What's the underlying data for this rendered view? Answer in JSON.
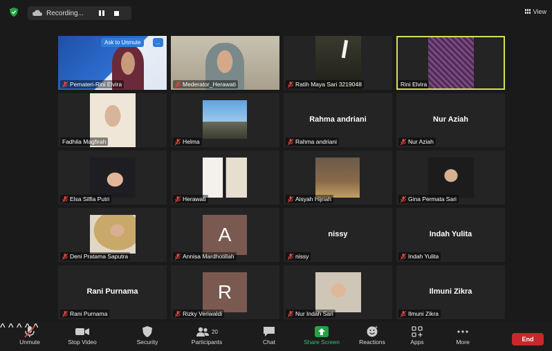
{
  "topbar": {
    "recording_label": "Recording...",
    "view_label": "View"
  },
  "tip": {
    "ask_unmute": "Ask to Unmute",
    "more": "..."
  },
  "tiles": [
    {
      "name": "Pemateri-Rini Elvira"
    },
    {
      "name": "Mederator_Herawati"
    },
    {
      "name": "Ratih Maya Sari 3219048"
    },
    {
      "name": "Rini Elvira"
    },
    {
      "name": "Fadhila Magfirah"
    },
    {
      "name": "Helma"
    },
    {
      "name": "Rahma andriani",
      "big": "Rahma andriani"
    },
    {
      "name": "Nur Aziah",
      "big": "Nur Aziah"
    },
    {
      "name": "Elsa Silfia Putri"
    },
    {
      "name": "Herawati"
    },
    {
      "name": "Aisyah Hijriah"
    },
    {
      "name": "Gina Permata Sari"
    },
    {
      "name": "Deni Pratama Saputra"
    },
    {
      "name": "Annisa Mardhotillah",
      "letter": "A"
    },
    {
      "name": "nissy",
      "big": "nissy"
    },
    {
      "name": "Indah Yulita",
      "big": "Indah Yulita"
    },
    {
      "name": "Rani Purnama",
      "big": "Rani Purnama"
    },
    {
      "name": "Rizky Veriwaldi",
      "letter": "R"
    },
    {
      "name": "Nur Indah Sari"
    },
    {
      "name": "Ilmuni Zikra",
      "big": "Ilmuni Zikra"
    }
  ],
  "toolbar": {
    "unmute": "Unmute",
    "stop_video": "Stop Video",
    "security": "Security",
    "participants": "Participants",
    "participants_count": "20",
    "chat": "Chat",
    "share_screen": "Share Screen",
    "reactions": "Reactions",
    "apps": "Apps",
    "more": "More",
    "end": "End"
  },
  "colors": {
    "active_speaker": "#d8e15a",
    "share_green": "#3ec06b",
    "end_red": "#c8282b",
    "tile_bg": "#242424"
  }
}
